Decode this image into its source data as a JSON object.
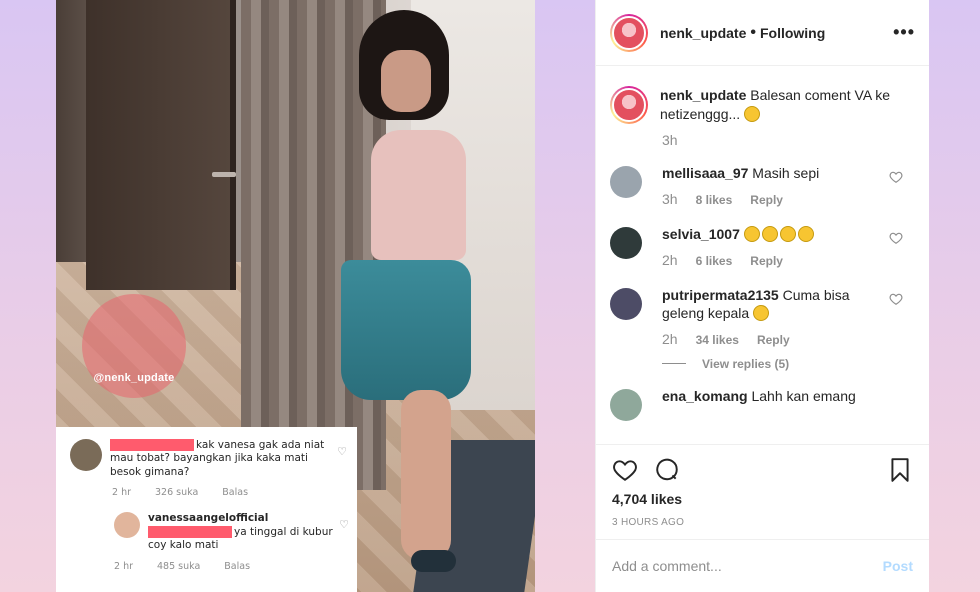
{
  "post": {
    "embedded_comments": [
      {
        "text": "kak vanesa gak ada niat mau tobat? bayangkan jika kaka mati besok gimana?",
        "time": "2 hr",
        "likes": "326 suka",
        "reply_label": "Balas"
      },
      {
        "username": "vanessaangelofficial",
        "text": "ya tinggal di kubur coy kalo mati",
        "time": "2 hr",
        "likes": "485 suka",
        "reply_label": "Balas"
      }
    ],
    "watermark": "@nenk_update"
  },
  "header": {
    "username": "nenk_update",
    "separator": "•",
    "follow_status": "Following",
    "more": "•••"
  },
  "caption": {
    "username": "nenk_update",
    "text": "Balesan coment VA ke netizenggg...",
    "time": "3h"
  },
  "comments": [
    {
      "username": "mellisaaa_97",
      "text": "Masih sepi",
      "time": "3h",
      "likes": "8 likes",
      "reply": "Reply"
    },
    {
      "username": "selvia_1007",
      "text": "",
      "time": "2h",
      "likes": "6 likes",
      "reply": "Reply"
    },
    {
      "username": "putripermata2135",
      "text": "Cuma bisa geleng kepala",
      "time": "2h",
      "likes": "34 likes",
      "reply": "Reply",
      "view_replies": "View replies (5)"
    },
    {
      "username": "ena_komang",
      "text": "Lahh kan emang"
    }
  ],
  "actions": {
    "likes": "4,704 likes",
    "posted": "3 HOURS AGO"
  },
  "add_comment": {
    "placeholder": "Add a comment...",
    "post_label": "Post"
  },
  "colors": {
    "link": "#262626",
    "muted": "#8e8e8e",
    "post_disabled": "#b3dbff",
    "redaction": "#ff5b6d"
  },
  "icons": [
    "heart-icon",
    "comment-icon",
    "bookmark-icon",
    "more-icon"
  ]
}
